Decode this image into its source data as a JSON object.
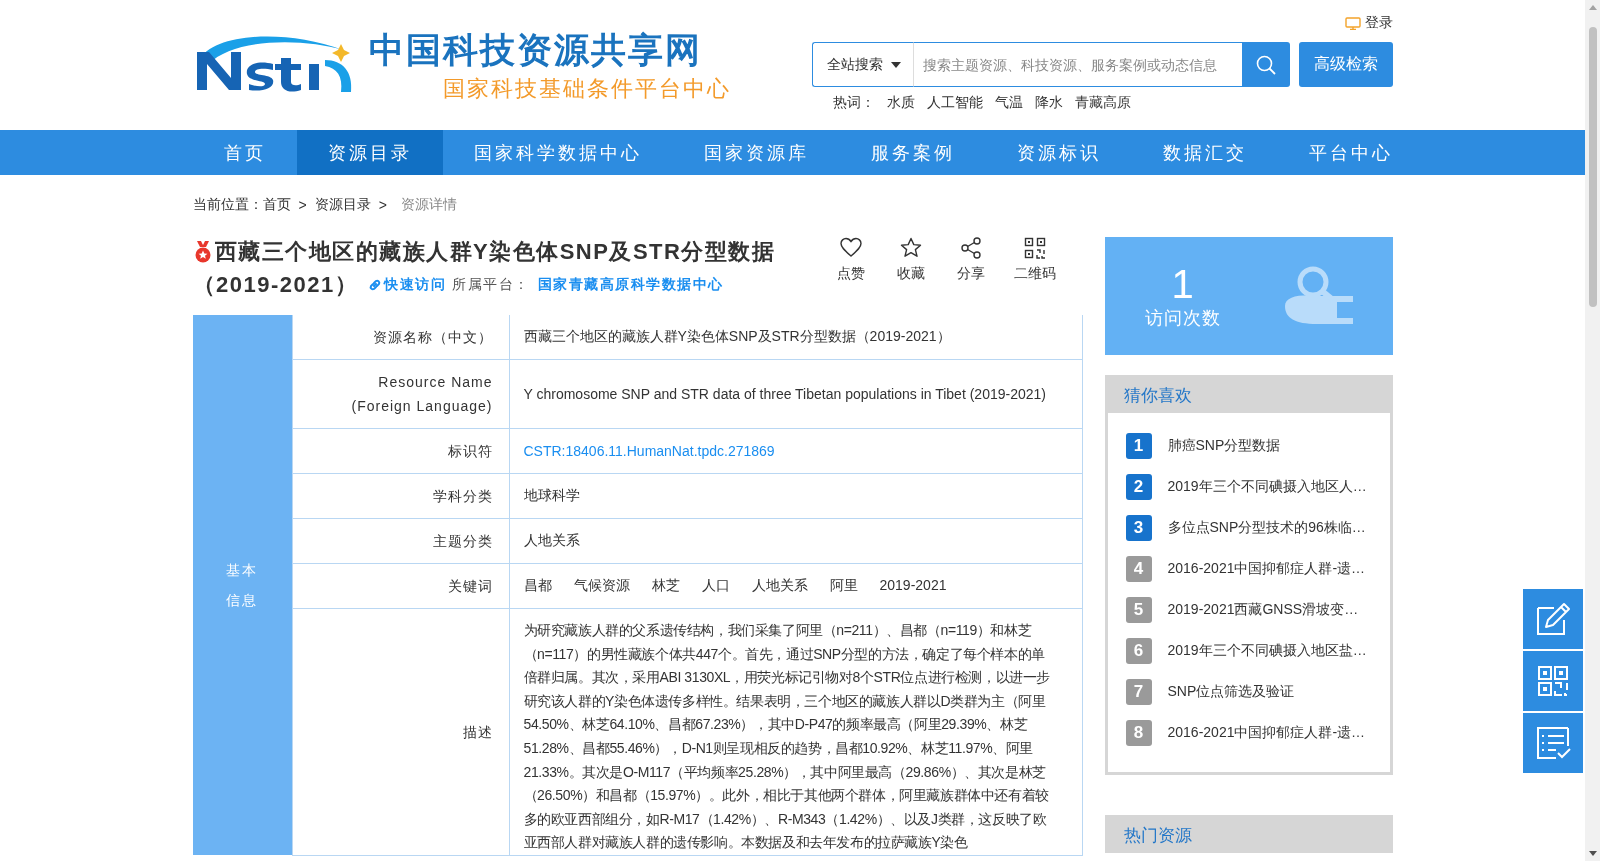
{
  "header": {
    "site_title": "中国科技资源共享网",
    "site_subtitle": "国家科技基础条件平台中心",
    "login": "登录",
    "search": {
      "scope": "全站搜索",
      "placeholder": "搜索主题资源、科技资源、服务案例或动态信息",
      "advanced": "高级检索"
    },
    "hot_words_label": "热词：",
    "hot_words": [
      "水质",
      "人工智能",
      "气温",
      "降水",
      "青藏高原"
    ]
  },
  "nav": [
    {
      "label": "首页",
      "selected": false
    },
    {
      "label": "资源目录",
      "selected": true
    },
    {
      "label": "国家科学数据中心",
      "selected": false
    },
    {
      "label": "国家资源库",
      "selected": false
    },
    {
      "label": "服务案例",
      "selected": false
    },
    {
      "label": "资源标识",
      "selected": false
    },
    {
      "label": "数据汇交",
      "selected": false
    },
    {
      "label": "平台中心",
      "selected": false
    }
  ],
  "breadcrumb": {
    "label": "当前位置：",
    "separator": ">",
    "items": [
      "首页",
      "资源目录"
    ],
    "current": "资源详情"
  },
  "resource": {
    "title": "西藏三个地区的藏族人群Y染色体SNP及STR分型数据",
    "title_years": "（2019-2021）",
    "quick_link": "快速访问",
    "platform_label": "所属平台：",
    "platform": "国家青藏高原科学数据中心"
  },
  "actions": [
    {
      "kind": "like",
      "label": "点赞"
    },
    {
      "kind": "favorite",
      "label": "收藏"
    },
    {
      "kind": "share",
      "label": "分享"
    },
    {
      "kind": "qrcode",
      "label": "二维码"
    }
  ],
  "info_table": {
    "group": "基本信息",
    "rows": [
      {
        "kind": "text",
        "label": "资源名称（中文）",
        "value": "西藏三个地区的藏族人群Y染色体SNP及STR分型数据（2019-2021）"
      },
      {
        "kind": "text",
        "label": "Resource Name (Foreign Language)",
        "value": "Y chromosome SNP and STR data of three Tibetan populations in Tibet (2019-2021)"
      },
      {
        "kind": "link",
        "label": "标识符",
        "value": "CSTR:18406.11.HumanNat.tpdc.271869"
      },
      {
        "kind": "text",
        "label": "学科分类",
        "value": "地球科学"
      },
      {
        "kind": "text",
        "label": "主题分类",
        "value": "人地关系"
      },
      {
        "kind": "keywords",
        "label": "关键词",
        "values": [
          "昌都",
          "气候资源",
          "林芝",
          "人口",
          "人地关系",
          "阿里",
          "2019-2021"
        ]
      },
      {
        "kind": "paragraph",
        "label": "描述",
        "value": "为研究藏族人群的父系遗传结构，我们采集了阿里（n=211）、昌都（n=119）和林芝（n=117）的男性藏族个体共447个。首先，通过SNP分型的方法，确定了每个样本的单倍群归属。其次，采用ABI 3130XL，用荧光标记引物对8个STR位点进行检测，以进一步研究该人群的Y染色体遗传多样性。结果表明，三个地区的藏族人群以D类群为主（阿里54.50%、林芝64.10%、昌都67.23%），其中D-P47的频率最高（阿里29.39%、林芝51.28%、昌都55.46%），D-N1则呈现相反的趋势，昌都10.92%、林芝11.97%、阿里21.33%。其次是O-M117（平均频率25.28%），其中阿里最高（29.86%）、其次是林芝（26.50%）和昌都（15.97%）。此外，相比于其他两个群体，阿里藏族群体中还有着较多的欧亚西部组分，如R-M17（1.42%）、R-M343（1.42%）、以及J类群，这反映了欧亚西部人群对藏族人群的遗传影响。本数据及和去年发布的拉萨藏族Y染色"
      }
    ]
  },
  "visits": {
    "count": "1",
    "label": "访问次数"
  },
  "recommend": {
    "title": "猜你喜欢",
    "items": [
      {
        "rank": "1",
        "title": "肺癌SNP分型数据",
        "hot": true
      },
      {
        "rank": "2",
        "title": "2019年三个不同碘摄入地区人…",
        "hot": true
      },
      {
        "rank": "3",
        "title": "多位点SNP分型技术的96株临…",
        "hot": true
      },
      {
        "rank": "4",
        "title": "2016-2021中国抑郁症人群-遗…",
        "hot": false
      },
      {
        "rank": "5",
        "title": "2019-2021西藏GNSS滑坡变…",
        "hot": false
      },
      {
        "rank": "6",
        "title": "2019年三个不同碘摄入地区盐…",
        "hot": false
      },
      {
        "rank": "7",
        "title": "SNP位点筛选及验证",
        "hot": false
      },
      {
        "rank": "8",
        "title": "2016-2021中国抑郁症人群-遗…",
        "hot": false
      }
    ]
  },
  "hot_resources": {
    "title": "热门资源"
  },
  "side_tools": [
    {
      "kind": "edit"
    },
    {
      "kind": "qrcode"
    },
    {
      "kind": "checklist"
    }
  ]
}
